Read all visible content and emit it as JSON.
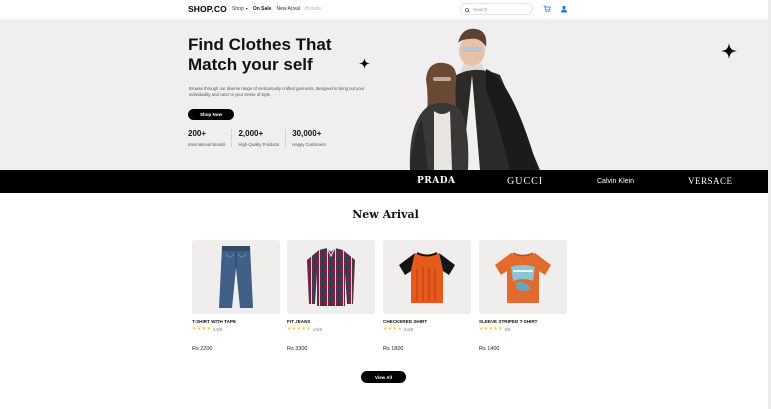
{
  "brand": "SHOP.CO",
  "nav": {
    "links": [
      {
        "label": "Shop",
        "has_dropdown": true,
        "dim": false
      },
      {
        "label": "On Sale",
        "has_dropdown": false,
        "dim": false
      },
      {
        "label": "New Arival",
        "has_dropdown": false,
        "dim": false
      },
      {
        "label": "Brands",
        "has_dropdown": false,
        "dim": true
      }
    ],
    "search_placeholder": "Search",
    "cart_icon": "cart-icon",
    "account_icon": "user-icon"
  },
  "hero": {
    "title_line1": "Find Clothes That",
    "title_line2": "Match your self",
    "description": "Browse through our diverse range of meticulously crafted garments, designed to bring out your individuality and cater to your sense of style.",
    "cta_label": "Shop Now",
    "stats": [
      {
        "value": "200+",
        "label": "International Brands"
      },
      {
        "value": "2,000+",
        "label": "High-Quality Products"
      },
      {
        "value": "30,000+",
        "label": "Happy Customers"
      }
    ]
  },
  "brands_bar": [
    "PRADA",
    "GUCCI",
    "Calvin Klein",
    "VERSACE"
  ],
  "new_arrival": {
    "title": "New Arival",
    "products": [
      {
        "name": "T-SHIRT WITH TAPE",
        "rating": 3.5,
        "rating_text": "3.5/5",
        "price": "Rs 2200"
      },
      {
        "name": "FIT JEANS",
        "rating": 4.5,
        "rating_text": "4.5/5",
        "price": "Rs 3300"
      },
      {
        "name": "CHECKERED SHIRT",
        "rating": 3.5,
        "rating_text": "3.5/5",
        "price": "Rs 1800"
      },
      {
        "name": "SLEEVE STRIPED T-SHIRT",
        "rating": 4.5,
        "rating_text": "5/5",
        "price": "Rs 1400"
      }
    ],
    "view_all_label": "View All"
  },
  "colors": {
    "hero_bg": "#f0eeef",
    "brands_bg": "#000000",
    "star": "#ffc633",
    "accent_blue": "#1a73e8"
  }
}
